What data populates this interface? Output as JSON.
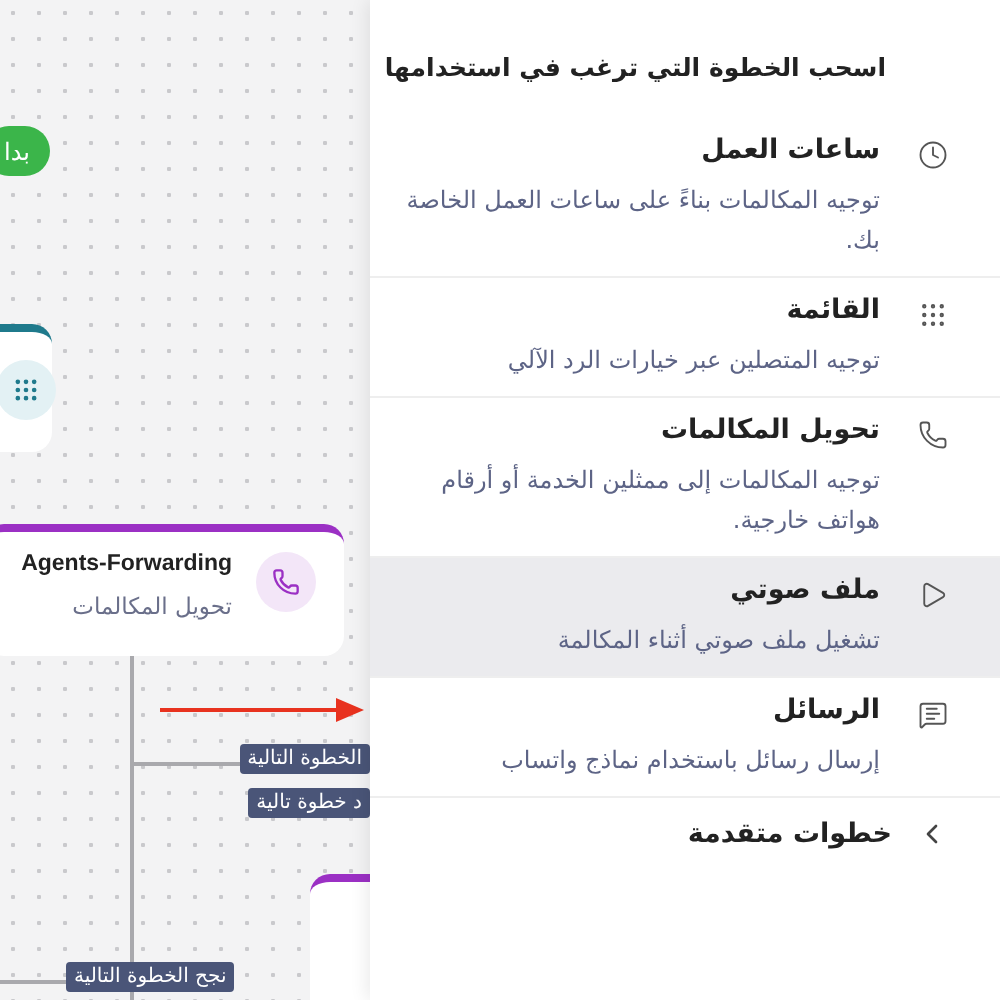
{
  "canvas": {
    "nodes": [
      {
        "kind": "start",
        "label": "بدا",
        "color": "#3bb54a"
      },
      {
        "kind": "menu",
        "color": "#1f7a8c"
      },
      {
        "kind": "step",
        "title": "Agents-Forwarding",
        "subtitle": "تحويل المكالمات",
        "color": "#9b30c4"
      },
      {
        "kind": "blank",
        "color": "#9b30c4"
      }
    ],
    "edge_labels": [
      "الخطوة التالية",
      "د خطوة تالية",
      "نجح الخطوة التالية"
    ]
  },
  "panel": {
    "title": "اسحب الخطوة التي ترغب في استخدامها",
    "steps": [
      {
        "kind": "clock",
        "title": "ساعات العمل",
        "description": "توجيه المكالمات بناءً على ساعات العمل الخاصة بك.",
        "selected": false
      },
      {
        "kind": "grid",
        "title": "القائمة",
        "description": "توجيه المتصلين عبر خيارات الرد الآلي",
        "selected": false
      },
      {
        "kind": "phone",
        "title": "تحويل المكالمات",
        "description": "توجيه المكالمات إلى ممثلين الخدمة أو أرقام هواتف خارجية.",
        "selected": false
      },
      {
        "kind": "play",
        "title": "ملف صوتي",
        "description": "تشغيل ملف صوتي أثناء المكالمة",
        "selected": true
      },
      {
        "kind": "message",
        "title": "الرسائل",
        "description": "إرسال رسائل باستخدام نماذج واتساب",
        "selected": false
      }
    ],
    "advanced": {
      "label": "خطوات متقدمة"
    }
  }
}
